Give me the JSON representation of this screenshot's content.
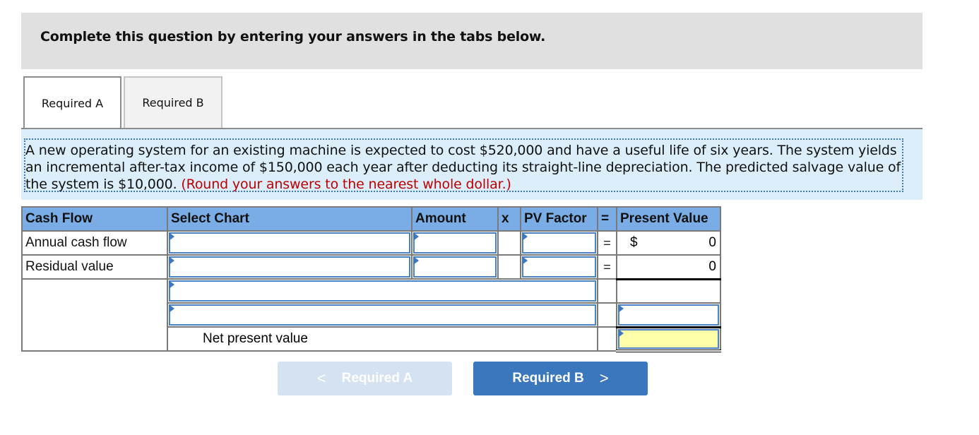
{
  "instructions": "Complete this question by entering your answers in the tabs below.",
  "tabs": [
    {
      "label": "Required A",
      "active": true
    },
    {
      "label": "Required B",
      "active": false
    }
  ],
  "problem": {
    "text": "A new operating system for an existing machine is expected to cost $520,000 and have a useful life of six years. The system yields an incremental after-tax income of $150,000 each year after deducting its straight-line depreciation. The predicted salvage value of the system is $10,000. ",
    "note": "(Round your answers to the nearest whole dollar.)"
  },
  "table": {
    "headers": {
      "cash_flow": "Cash Flow",
      "select_chart": "Select Chart",
      "amount": "Amount",
      "times": "x",
      "pv_factor": "PV Factor",
      "equals": "=",
      "present_value": "Present Value"
    },
    "rows": [
      {
        "label": "Annual cash flow",
        "chart": "",
        "amount": "",
        "pv_factor": "",
        "eq": "=",
        "currency": "$",
        "present_value": "0"
      },
      {
        "label": "Residual value",
        "chart": "",
        "amount": "",
        "pv_factor": "",
        "eq": "=",
        "currency": "",
        "present_value": "0"
      }
    ],
    "extra_row_1": {
      "input": "",
      "present_value": ""
    },
    "extra_row_2": {
      "input": "",
      "present_value": ""
    },
    "npv": {
      "label": "Net present value",
      "value": ""
    }
  },
  "nav": {
    "prev_label": "Required A",
    "next_label": "Required B",
    "prev_enabled": false
  },
  "colors": {
    "header_bg": "#7aade6",
    "accent": "#3b77bd",
    "note_red": "#c00000",
    "npv_highlight": "#ffffaa"
  }
}
